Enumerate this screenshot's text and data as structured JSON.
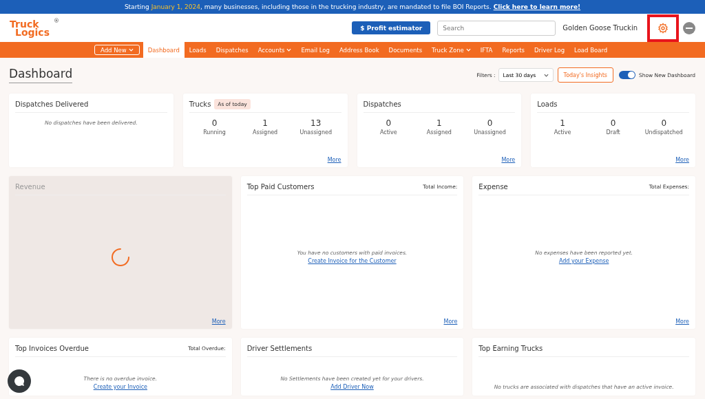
{
  "banner": {
    "prefix": "Starting",
    "date": "January 1, 2024",
    "rest": ", many businesses, including those in the trucking industry, are mandated to file BOI Reports.",
    "link": "Click here to learn more!"
  },
  "header": {
    "logo_top": "Truck",
    "logo_bottom": "Logics",
    "logo_mark": "®",
    "profit_button": "$ Profit estimator",
    "search": {
      "placeholder": "Search"
    },
    "company": "Golden Goose Truckin"
  },
  "nav": {
    "add_new": "Add New",
    "items": [
      {
        "label": "Dashboard",
        "selected": true,
        "dropdown": false
      },
      {
        "label": "Loads",
        "selected": false,
        "dropdown": false
      },
      {
        "label": "Dispatches",
        "selected": false,
        "dropdown": false
      },
      {
        "label": "Accounts",
        "selected": false,
        "dropdown": true
      },
      {
        "label": "Email Log",
        "selected": false,
        "dropdown": false
      },
      {
        "label": "Address Book",
        "selected": false,
        "dropdown": false
      },
      {
        "label": "Documents",
        "selected": false,
        "dropdown": false
      },
      {
        "label": "Truck Zone",
        "selected": false,
        "dropdown": true
      },
      {
        "label": "IFTA",
        "selected": false,
        "dropdown": false
      },
      {
        "label": "Reports",
        "selected": false,
        "dropdown": false
      },
      {
        "label": "Driver Log",
        "selected": false,
        "dropdown": false
      },
      {
        "label": "Load Board",
        "selected": false,
        "dropdown": false
      }
    ]
  },
  "page": {
    "title": "Dashboard",
    "filters_label": "Filters :",
    "filter_value": "Last 30 days",
    "insights_button": "Today's Insights",
    "toggle": {
      "label": "Show New Dashboard",
      "on": true
    }
  },
  "summary_cards": [
    {
      "title": "Dispatches Delivered",
      "message": "No dispatches have been delivered."
    },
    {
      "title": "Trucks",
      "badge": "As of today",
      "stats": [
        {
          "value": "0",
          "label": "Running"
        },
        {
          "value": "1",
          "label": "Assigned"
        },
        {
          "value": "13",
          "label": "Unassigned"
        }
      ],
      "more": "More"
    },
    {
      "title": "Dispatches",
      "stats": [
        {
          "value": "0",
          "label": "Active"
        },
        {
          "value": "1",
          "label": "Assigned"
        },
        {
          "value": "0",
          "label": "Unassigned"
        }
      ],
      "more": "More"
    },
    {
      "title": "Loads",
      "stats": [
        {
          "value": "1",
          "label": "Active"
        },
        {
          "value": "0",
          "label": "Draft"
        },
        {
          "value": "0",
          "label": "Undispatched"
        }
      ],
      "more": "More"
    }
  ],
  "panels": [
    {
      "kind": "loading",
      "title": "Revenue",
      "more": "More"
    },
    {
      "kind": "empty",
      "title": "Top Paid Customers",
      "total_label": "Total Income:",
      "message": "You have no customers with paid invoices.",
      "link": "Create Invoice for the Customer",
      "more": "More"
    },
    {
      "kind": "empty",
      "title": "Expense",
      "total_label": "Total Expenses:",
      "message": "No expenses have been reported yet.",
      "link": "Add your Expense",
      "more": "More"
    },
    {
      "kind": "empty",
      "title": "Top Invoices Overdue",
      "total_label": "Total Overdue:",
      "message": "There is no overdue invoice.",
      "link": "Create your Invoice"
    },
    {
      "kind": "empty",
      "title": "Driver Settlements",
      "message": "No Settlements have been created yet for your drivers.",
      "link": "Add Driver Now"
    },
    {
      "kind": "empty",
      "title": "Top Earning Trucks",
      "message": "No trucks are associated with dispatches that have an active invoice."
    }
  ]
}
